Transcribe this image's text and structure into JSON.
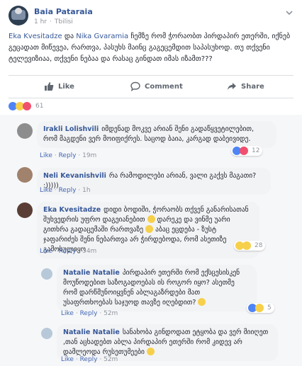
{
  "post": {
    "author": "Baia Pataraia",
    "time": "1 hr",
    "location": "Tbilisi",
    "text_tag1": "Eka Kvesitadze",
    "text_and": " და ",
    "text_tag2": "Nika Gvaramia",
    "text_body": " ჩემზე რომ ჭორაობთ პირდაპირ ეთერში, იქნებ გეცადათ მიწევეა, რართვა, პასუხს მაინც გაგეცემდით საპასუხოდ. თუ თქვენი ტელევიზიაა, თქვენი ნებაა და რასაც გინდათ იმას იზამთ???",
    "actions": {
      "like": "Like",
      "comment": "Comment",
      "share": "Share"
    },
    "reaction_count": "61"
  },
  "comments": [
    {
      "author": "Irakli Lolishvili",
      "text": "იმდენად მოკვე არიან შენი გადაწყვეტილებით, რომ მაგდენი ვერ მოიფიქრეს. საცოდ ბაია, კარგად დაბეივიდე.",
      "like": "Like",
      "reply": "Reply",
      "time": "19m",
      "reactions": "12"
    },
    {
      "author": "Neli Kevanishvili",
      "text": "რა რამოდილები არიან, ვალი გაქვს მაგათი? :)))))",
      "like": "Like",
      "reply": "Reply",
      "time": "1h"
    },
    {
      "author": "Eka Kvesitadze",
      "text": "დიდი ბოდიში, ჭორაობს თქვენ განარისათან შუხვედრის უფრო დაგეიანებით",
      "text2": "დარეკე და ვინმე უარი გითხრა გადაცემაში რართვაზე",
      "text3": "აბაც ეცდება - ზუსტ ჯაფარიძეს შენი ნებართვა არ ჭირდებოდა, რომ ასეთიზე გამოსულიყო",
      "like": "Like",
      "reply": "Reply",
      "time": "54m",
      "reactions": "28"
    }
  ],
  "replies": [
    {
      "author": "Natalie Natalie",
      "text": "პირდაპირ ეთერში რომ ექსცესისკენ მოუწოდებით საზოგადოებას ის როგორ იყო? ასეთმე რომ დარწმუნოიყვნენ აბლაგაზრდები მათ უსაფრთხოებას საჯუოდ თავზე იღებდით?",
      "like": "Like",
      "reply": "Reply",
      "time": "52m",
      "reactions": "5"
    },
    {
      "author": "Natalie Natalie",
      "text": "სანახობა გინდოდათ ეტყობა და ვერ მიიღეთ ,თან აცხადებთ აბლა პირდაპირ ეთერში რომ კიდევ არ დამლეოდა რუსეთუმეები",
      "like": "Like",
      "reply": "Reply",
      "time": "52m"
    }
  ],
  "colors": {
    "link": "#365899",
    "accent": "#4267b2",
    "muted": "#90949c"
  }
}
